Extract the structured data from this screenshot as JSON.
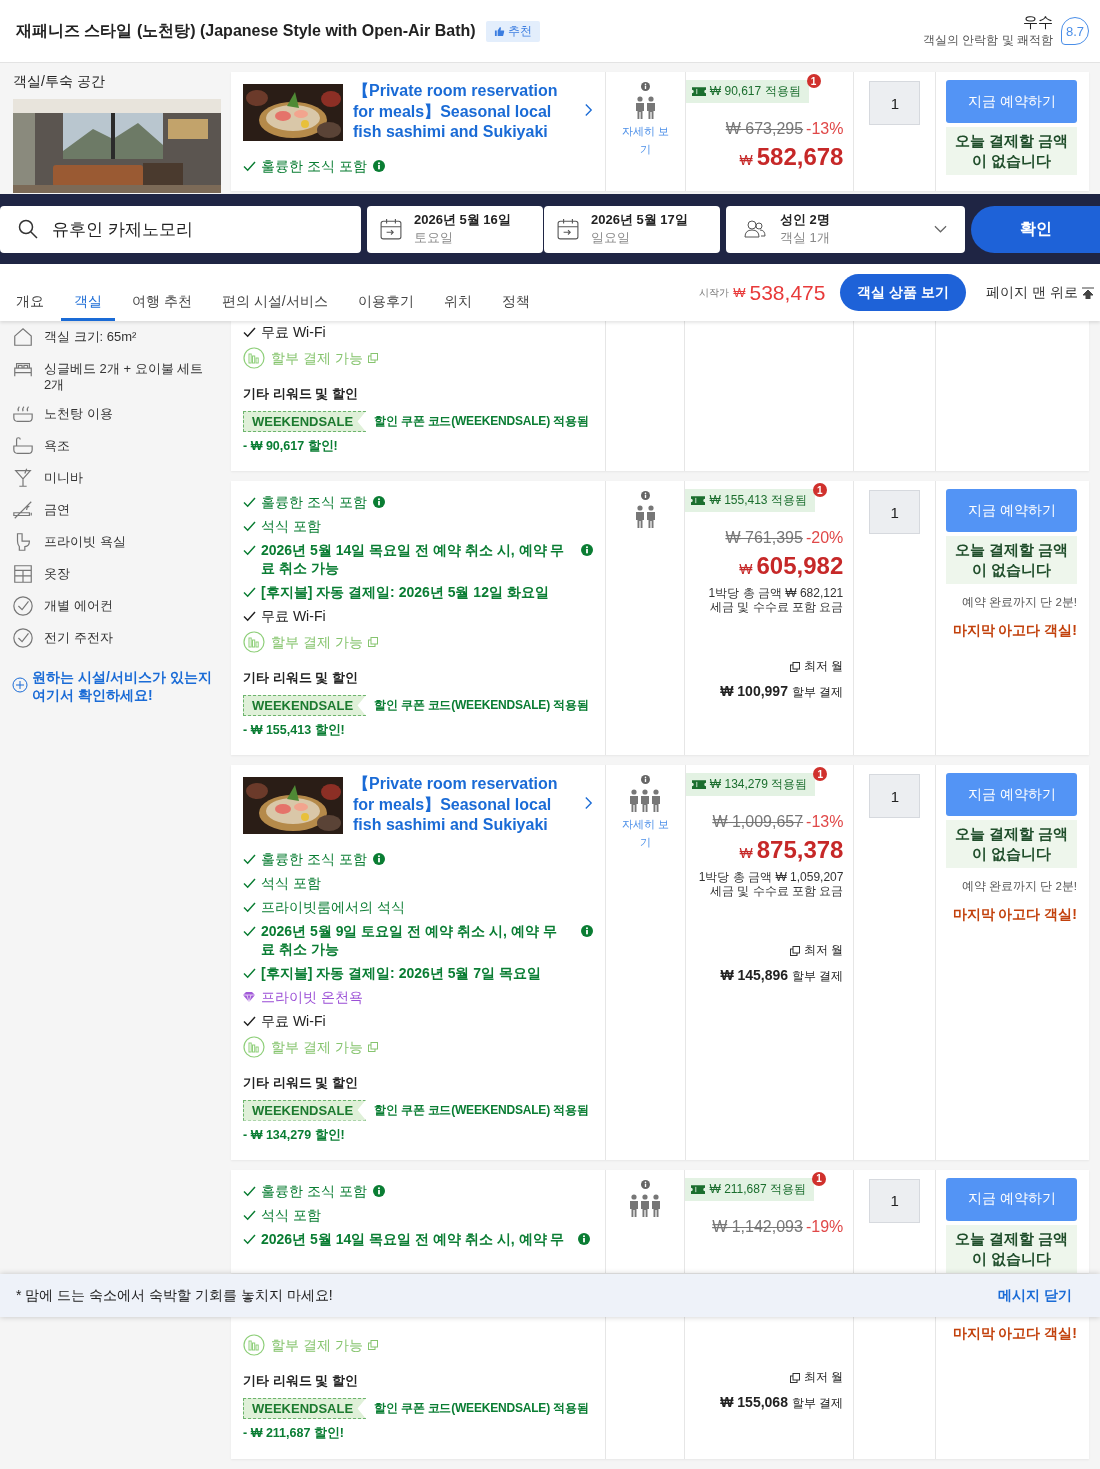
{
  "room_header": {
    "title": "재패니즈 스타일 (노천탕) (Japanese Style with Open-Air Bath)",
    "badge": "추천",
    "rating": {
      "label": "우수",
      "caption": "객실의 안락함 및 쾌적함",
      "score": "8.7"
    }
  },
  "room_info": {
    "heading": "객실/투숙 공간",
    "photo": {
      "kind": "picture"
    }
  },
  "offer_top": {
    "image": {
      "kind": "picture"
    },
    "title": "【Private room reservation for meals】Seasonal local fish sashimi and Sukiyaki",
    "features": [
      {
        "kind": "included",
        "text": "훌륭한 조식 포함",
        "info": true
      }
    ],
    "occupants": [
      {
        "kind": "adult"
      },
      {
        "kind": "adult"
      }
    ],
    "details_link": "자세히 보기",
    "price": {
      "applied": "₩ 90,617 적용됨",
      "alert": "1",
      "original": "₩ 673,295",
      "discount": "-13%",
      "currency": "₩",
      "amount": "582,678"
    },
    "quantity": "1",
    "booking": {
      "button": "지금 예약하기",
      "notice": "오늘 결제할 금액이 없습니다"
    }
  },
  "search_bar": {
    "destination": "유후인 카제노모리",
    "check_in": {
      "date": "2026년 5월 16일",
      "weekday": "토요일"
    },
    "check_out": {
      "date": "2026년 5월 17일",
      "weekday": "일요일"
    },
    "guests": {
      "adults": "성인 2명",
      "rooms": "객실 1개"
    },
    "button": "확인"
  },
  "nav": {
    "tabs": [
      {
        "label": "개요",
        "selected": false
      },
      {
        "label": "객실",
        "selected": true
      },
      {
        "label": "여행 추천",
        "selected": false
      },
      {
        "label": "편의 시설/서비스",
        "selected": false
      },
      {
        "label": "이용후기",
        "selected": false
      },
      {
        "label": "위치",
        "selected": false
      },
      {
        "label": "정책",
        "selected": false
      }
    ],
    "price_label": "시작가",
    "currency": "₩",
    "price": "538,475",
    "button": "객실 상품 보기",
    "top_link": "페이지 맨 위로"
  },
  "amenities": {
    "items": [
      "객실 크기: 65m²",
      "싱글베드 2개 + 요이불 세트 2개",
      "노천탕 이용",
      "욕조",
      "미니바",
      "금연",
      "프라이빗 욕실",
      "옷장",
      "개별 에어컨",
      "전기 주전자"
    ],
    "link": "원하는 시설/서비스가 있는지 여기서 확인하세요!"
  },
  "offers": [
    {
      "features": [
        {
          "kind": "basic",
          "text": "무료 Wi-Fi",
          "info": false
        },
        {
          "kind": "installment",
          "text": "할부 결제 가능",
          "info": false
        }
      ],
      "rewards": {
        "heading": "기타 리워드 및 할인",
        "code": "WEEKENDSALE",
        "text": "할인 쿠폰 코드(WEEKENDSALE) 적용됨",
        "discount": "- ₩ 90,617 할인!"
      }
    },
    {
      "features": [
        {
          "kind": "included",
          "text": "훌륭한 조식 포함",
          "info": true
        },
        {
          "kind": "included",
          "text": "석식 포함",
          "info": false
        },
        {
          "kind": "policy",
          "text": "2026년 5월 14일 목요일 전 예약 취소 시, 예약 무료 취소 가능",
          "info": true
        },
        {
          "kind": "policy",
          "text": "[후지불] 자동 결제일: 2026년 5월 12일 화요일",
          "info": false
        },
        {
          "kind": "basic",
          "text": "무료 Wi-Fi",
          "info": false
        },
        {
          "kind": "installment",
          "text": "할부 결제 가능",
          "info": false
        }
      ],
      "rewards": {
        "heading": "기타 리워드 및 할인",
        "code": "WEEKENDSALE",
        "text": "할인 쿠폰 코드(WEEKENDSALE) 적용됨",
        "discount": "- ₩ 155,413 할인!"
      },
      "occupants": [
        {
          "kind": "adult"
        },
        {
          "kind": "adult"
        }
      ],
      "price": {
        "applied": "₩ 155,413 적용됨",
        "alert": "1",
        "original": "₩ 761,395",
        "discount": "-20%",
        "currency": "₩",
        "amount": "605,982",
        "per_night": "1박당 총 금액 ₩ 682,121",
        "tax_note": "세금 및 수수료 포함 요금",
        "monthly_label": "최저 월",
        "monthly_amount": "₩ 100,997",
        "monthly_suffix": "할부 결제"
      },
      "quantity": "1",
      "booking": {
        "button": "지금 예약하기",
        "notice": "오늘 결제할 금액이 없습니다",
        "hint": "예약 완료까지 단 2분!",
        "last_room": "마지막 아고다 객실!"
      }
    },
    {
      "image": {
        "kind": "picture"
      },
      "title": "【Private room reservation for meals】Seasonal local fish sashimi and Sukiyaki",
      "features": [
        {
          "kind": "included",
          "text": "훌륭한 조식 포함",
          "info": true
        },
        {
          "kind": "included",
          "text": "석식 포함",
          "info": false
        },
        {
          "kind": "included",
          "text": "프라이빗룸에서의 석식",
          "info": false
        },
        {
          "kind": "policy",
          "text": "2026년 5월 9일 토요일 전 예약 취소 시, 예약 무료 취소 가능",
          "info": true
        },
        {
          "kind": "policy",
          "text": "[후지불] 자동 결제일: 2026년 5월 7일 목요일",
          "info": false
        },
        {
          "kind": "perk",
          "text": "프라이빗 온천욕",
          "info": false
        },
        {
          "kind": "basic",
          "text": "무료 Wi-Fi",
          "info": false
        },
        {
          "kind": "installment",
          "text": "할부 결제 가능",
          "info": false
        }
      ],
      "rewards": {
        "heading": "기타 리워드 및 할인",
        "code": "WEEKENDSALE",
        "text": "할인 쿠폰 코드(WEEKENDSALE) 적용됨",
        "discount": "- ₩ 134,279 할인!"
      },
      "occupants": [
        {
          "kind": "adult"
        },
        {
          "kind": "adult"
        },
        {
          "kind": "adult"
        }
      ],
      "details_link": "자세히 보기",
      "price": {
        "applied": "₩ 134,279 적용됨",
        "alert": "1",
        "original": "₩ 1,009,657",
        "discount": "-13%",
        "currency": "₩",
        "amount": "875,378",
        "per_night": "1박당 총 금액 ₩ 1,059,207",
        "tax_note": "세금 및 수수료 포함 요금",
        "monthly_label": "최저 월",
        "monthly_amount": "₩ 145,896",
        "monthly_suffix": "할부 결제"
      },
      "quantity": "1",
      "booking": {
        "button": "지금 예약하기",
        "notice": "오늘 결제할 금액이 없습니다",
        "hint": "예약 완료까지 단 2분!",
        "last_room": "마지막 아고다 객실!"
      }
    },
    {
      "features": [
        {
          "kind": "included",
          "text": "훌륭한 조식 포함",
          "info": true
        },
        {
          "kind": "included",
          "text": "석식 포함",
          "info": false
        },
        {
          "kind": "policy",
          "text": "2026년 5월 14일 목요일 전 예약 취소 시, 예약 무",
          "info": true
        }
      ],
      "occupants": [
        {
          "kind": "adult"
        },
        {
          "kind": "adult"
        },
        {
          "kind": "adult"
        }
      ],
      "price": {
        "applied": "₩ 211,687 적용됨",
        "alert": "1",
        "original": "₩ 1,142,093",
        "discount": "-19%"
      },
      "quantity": "1",
      "booking": {
        "button": "지금 예약하기",
        "notice": "오늘 결제할 금액이 없습니다"
      }
    }
  ],
  "notice_banner": {
    "text": "* 맘에 드는 숙소에서 숙박할 기회를 놓치지 마세요!",
    "close": "메시지 닫기"
  },
  "offer_bottom": {
    "features": [
      {
        "kind": "installment",
        "text": "할부 결제 가능",
        "info": false
      }
    ],
    "rewards": {
      "heading": "기타 리워드 및 할인",
      "code": "WEEKENDSALE",
      "text": "할인 쿠폰 코드(WEEKENDSALE) 적용됨",
      "discount": "- ₩ 211,687 할인!"
    },
    "price": {
      "monthly_label": "최저 월",
      "monthly_amount": "₩ 155,068",
      "monthly_suffix": "할부 결제"
    },
    "booking": {
      "last_room": "마지막 아고다 객실!"
    }
  }
}
